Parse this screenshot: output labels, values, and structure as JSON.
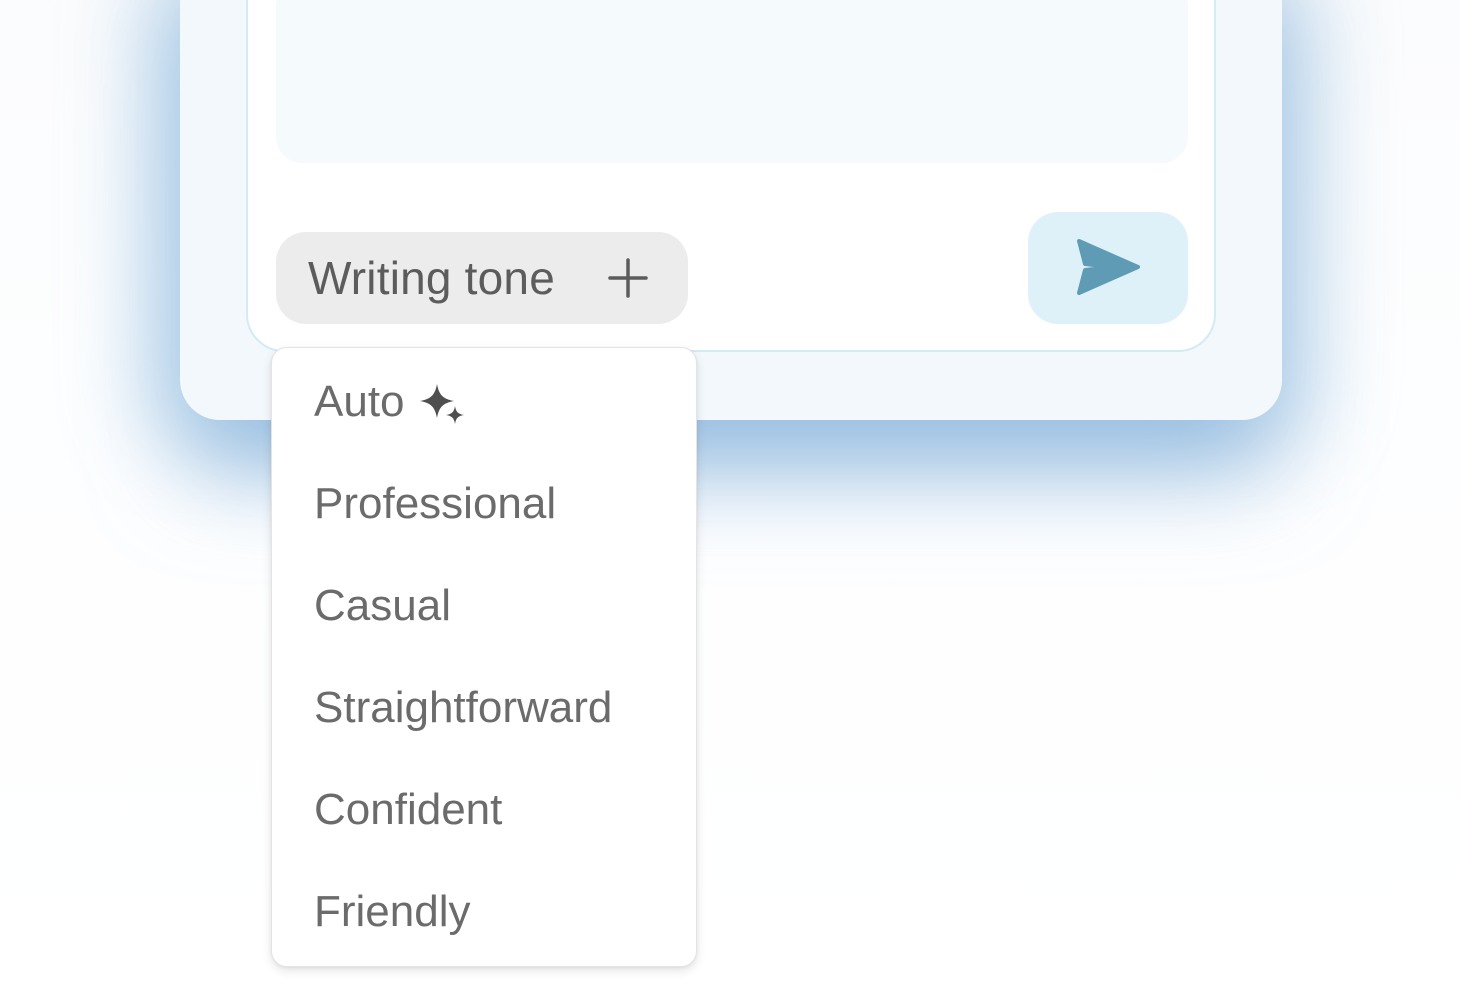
{
  "composer": {
    "tone_chip": {
      "label": "Writing tone",
      "icon": "plus-icon"
    },
    "send_button": {
      "icon": "send-icon",
      "icon_color": "#5f9bb5",
      "background": "#def0f8"
    }
  },
  "tone_menu": {
    "items": [
      {
        "label": "Auto",
        "icon": "sparkle-icon"
      },
      {
        "label": "Professional"
      },
      {
        "label": "Casual"
      },
      {
        "label": "Straightforward"
      },
      {
        "label": "Confident"
      },
      {
        "label": "Friendly"
      }
    ]
  },
  "colors": {
    "card_background": "#f2f8fc",
    "chip_background": "#ececec",
    "menu_text": "#6b6b6b",
    "accent_shadow": "#78aad7"
  }
}
